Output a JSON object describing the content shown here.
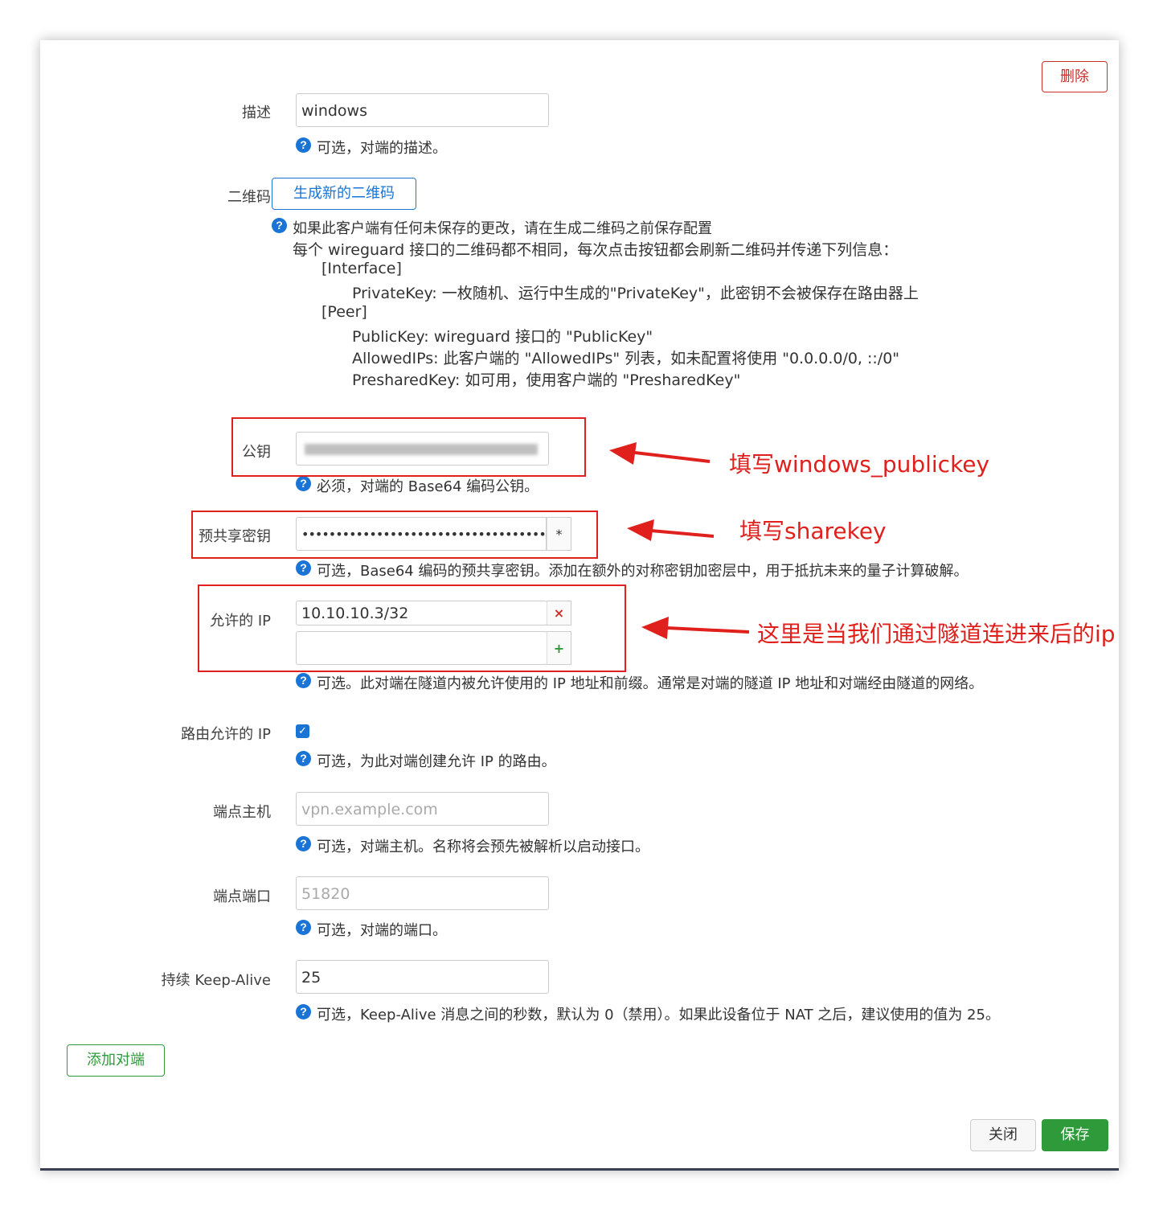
{
  "buttons": {
    "delete": "删除",
    "generate_qr": "生成新的二维码",
    "add_peer": "添加对端",
    "close": "关闭",
    "save": "保存"
  },
  "fields": {
    "description": {
      "label": "描述",
      "value": "windows",
      "help": "可选，对端的描述。"
    },
    "qrcode": {
      "label": "二维码",
      "help_lines": [
        "如果此客户端有任何未保存的更改，请在生成二维码之前保存配置",
        "每个 wireguard 接口的二维码都不相同，每次点击按钮都会刷新二维码并传递下列信息：",
        "[Interface]",
        "PrivateKey: 一枚随机、运行中生成的\"PrivateKey\"，此密钥不会被保存在路由器上",
        "[Peer]",
        "PublicKey: wireguard 接口的 \"PublicKey\"",
        "AllowedIPs: 此客户端的 \"AllowedIPs\" 列表，如未配置将使用 \"0.0.0.0/0, ::/0\"",
        "PresharedKey: 如可用，使用客户端的 \"PresharedKey\""
      ]
    },
    "public_key": {
      "label": "公钥",
      "help": "必须，对端的 Base64 编码公钥。"
    },
    "preshared_key": {
      "label": "预共享密钥",
      "value": "••••••••••••••••••••••••••••••••••••••••••••",
      "toggle": "*",
      "help": "可选，Base64 编码的预共享密钥。添加在额外的对称密钥加密层中，用于抵抗未来的量子计算破解。"
    },
    "allowed_ips": {
      "label": "允许的 IP",
      "values": [
        "10.10.10.3/32"
      ],
      "remove": "×",
      "add": "+",
      "help": "可选。此对端在隧道内被允许使用的 IP 地址和前缀。通常是对端的隧道 IP 地址和对端经由隧道的网络。"
    },
    "route_allowed_ips": {
      "label": "路由允许的 IP",
      "checked": true,
      "help": "可选，为此对端创建允许 IP 的路由。"
    },
    "endpoint_host": {
      "label": "端点主机",
      "placeholder": "vpn.example.com",
      "help": "可选，对端主机。名称将会预先被解析以启动接口。"
    },
    "endpoint_port": {
      "label": "端点端口",
      "placeholder": "51820",
      "help": "可选，对端的端口。"
    },
    "keepalive": {
      "label": "持续 Keep-Alive",
      "value": "25",
      "help": "可选，Keep-Alive 消息之间的秒数，默认为 0（禁用）。如果此设备位于 NAT 之后，建议使用的值为 25。"
    }
  },
  "annotations": {
    "public_key": "填写windows_publickey",
    "preshared_key": "填写sharekey",
    "allowed_ips": "这里是当我们通过隧道连进来后的ip"
  },
  "colors": {
    "annotation_red": "#e0201c",
    "help_icon_blue": "#1a74d6",
    "save_green": "#2e9a3a",
    "delete_red": "#c9302c",
    "qr_blue": "#1a74d6"
  }
}
